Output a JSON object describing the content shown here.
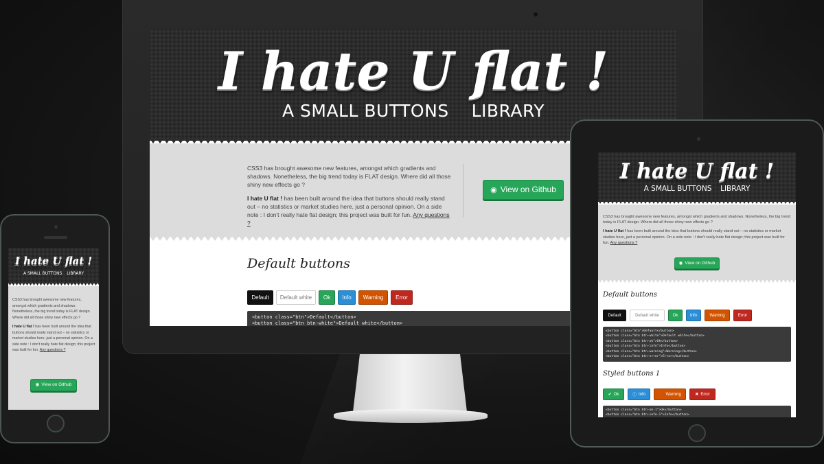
{
  "site": {
    "title": "I hate U flat !",
    "subtitle_a": "A SMALL BUTTONS",
    "subtitle_b": "LIBRARY",
    "intro_1": "CSS3 has brought awesome new features, amongst which gradients and shadows. Nonetheless, the big trend today is FLAT design. Where did all those shiny new effects go ?",
    "intro_2_bold": "I hate U flat !",
    "intro_2_rest": " has been built around the idea that buttons should really stand out – no statistics or market studies here, just a personal opinion. On a side note : I don't really hate flat design; this project was built for fun. ",
    "questions_link": "Any questions ?",
    "github_button": "View on Github",
    "github_icon": "github-octocat-icon",
    "default_heading": "Default buttons",
    "styled_heading": "Styled buttons 1",
    "buttons": [
      "Default",
      "Default white",
      "Ok",
      "Info",
      "Warning",
      "Error"
    ],
    "styled_buttons": [
      "Ok",
      "Info",
      "Warning",
      "Error"
    ],
    "styled_icons": [
      "check-circle-icon",
      "info-circle-icon",
      "exclamation-circle-icon",
      "close-circle-icon"
    ],
    "code_default": "<button class=\"btn\">Default</button>\n<button class=\"btn btn-white\">Default white</button>\n<button class=\"btn btn-ok\">Ok</button>\n<button class=\"btn btn-info\">Info</button>\n<button class=\"btn btn-warning\">Warning</button>\n<button class=\"btn btn-error\">Error</button>",
    "code_styled": "<button class=\"btn btn-ok-1\">Ok</button>\n<button class=\"btn btn-info-1\">Info</button>"
  },
  "colors": {
    "ok": "#27a559",
    "info": "#2a8fd6",
    "warning": "#d35400",
    "error": "#c0281f",
    "default": "#111111",
    "header_bg": "#2c2c2c",
    "intro_bg": "#dcdcdc"
  }
}
